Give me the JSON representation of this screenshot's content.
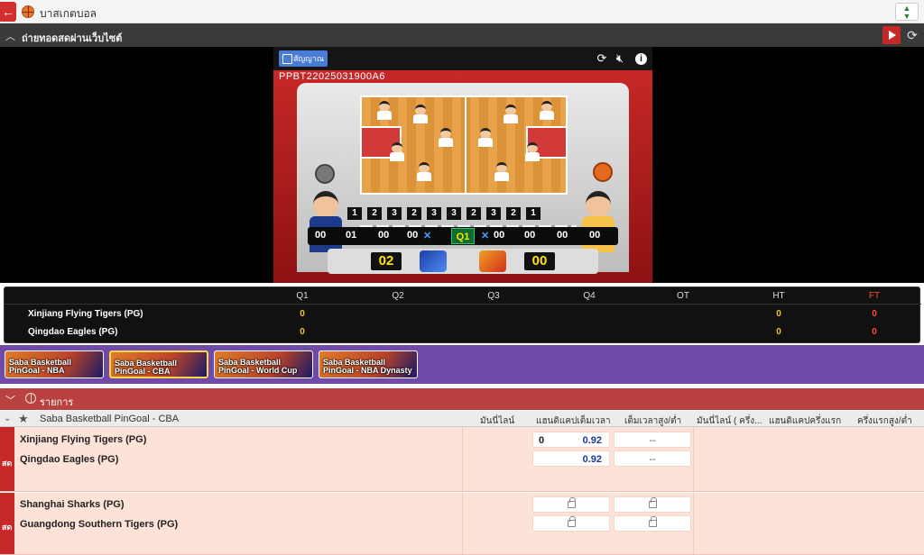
{
  "app": {
    "title": "บาสเกตบอล",
    "back_icon": "back-arrow-icon",
    "settings_icon": "odds-settings-icon"
  },
  "stream": {
    "title": "ถ่ายทอดสดผ่านเว็บไซต์",
    "chevron_icon": "chevron-up-icon",
    "play_icon": "play-icon",
    "refresh_icon": "refresh-icon"
  },
  "video": {
    "signal_label": "สัญญาณ",
    "match_code": "PPBT22025031900A6",
    "icons": [
      "reload-icon",
      "mute-icon",
      "info-icon"
    ],
    "numbers": [
      "1",
      "2",
      "3",
      "2",
      "3",
      "3",
      "2",
      "3",
      "2",
      "1"
    ],
    "strip": {
      "left_a": "00",
      "left_b": "01",
      "left_c": "00",
      "left_d": "00",
      "quarter": "Q1",
      "right_a": "00",
      "right_b": "00",
      "right_c": "00",
      "right_d": "00"
    },
    "score_left": "02",
    "score_right": "00"
  },
  "scoreboard": {
    "columns": [
      "Q1",
      "Q2",
      "Q3",
      "Q4",
      "OT",
      "HT",
      "FT"
    ],
    "rows": [
      {
        "team": "Xinjiang Flying Tigers (PG)",
        "q1": "0",
        "ht": "0",
        "ft": "0"
      },
      {
        "team": "Qingdao Eagles (PG)",
        "q1": "0",
        "ht": "0",
        "ft": "0"
      }
    ]
  },
  "games": [
    {
      "label": "Saba Basketball PinGoal - NBA",
      "selected": false
    },
    {
      "label": "Saba Basketball PinGoal - CBA",
      "selected": true
    },
    {
      "label": "Saba Basketball PinGoal - World Cup",
      "selected": false
    },
    {
      "label": "Saba Basketball PinGoal - NBA Dynasty",
      "selected": false
    }
  ],
  "list": {
    "title": "รายการ"
  },
  "league": {
    "name": "Saba Basketball PinGoal - CBA",
    "columns": [
      "มันนี่ไลน์",
      "แฮนดิแคปเต็มเวลา",
      "เต็มเวลาสูง/ต่ำ",
      "มันนี่ไลน์ ( ครึ่ง...",
      "แฮนดิแคปครึ่งแรก",
      "ครึ่งแรกสูง/ต่ำ"
    ]
  },
  "matches": [
    {
      "live_label": "สด",
      "home": "Xinjiang Flying Tigers (PG)",
      "away": "Qingdao Eagles (PG)",
      "home_hcap": "0",
      "home_price": "0.92",
      "away_price": "0.92",
      "home_ou": "--",
      "away_ou": "--",
      "locked": false
    },
    {
      "live_label": "สด",
      "home": "Shanghai Sharks (PG)",
      "away": "Guangdong Southern Tigers (PG)",
      "locked": true
    }
  ],
  "colors": {
    "accent_red": "#c62828",
    "purple": "#6f4aa9",
    "price_blue": "#1a3a8f",
    "score_yellow": "#f0c419",
    "ft_red": "#ff4d2e"
  }
}
